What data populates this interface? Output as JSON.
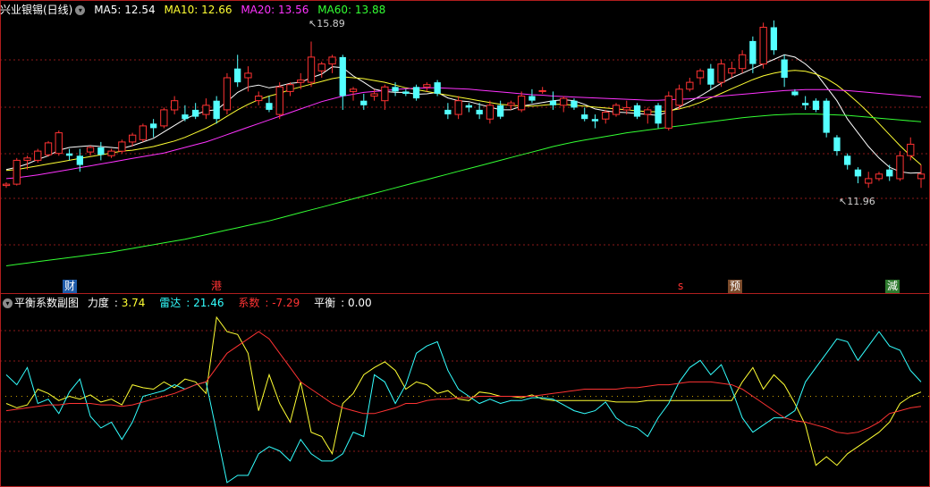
{
  "main_header": {
    "symbol": "兴业银锡(日线)",
    "ma": [
      {
        "label": "MA5: 12.54",
        "color": "#ffffff"
      },
      {
        "label": "MA10: 12.66",
        "color": "#ffff33"
      },
      {
        "label": "MA20: 13.56",
        "color": "#ff33ff"
      },
      {
        "label": "MA60: 13.88",
        "color": "#33ff33"
      }
    ]
  },
  "sub_header": {
    "name": "平衡系数副图",
    "items": [
      {
        "name": "力度",
        "value": "3.74",
        "color": "#ffff33"
      },
      {
        "name": "雷达",
        "value": "21.46",
        "color": "#33ffff"
      },
      {
        "name": "系数",
        "value": "-7.29",
        "color": "#ff3333"
      },
      {
        "name": "平衡",
        "value": "0.00",
        "color": "#ffffff"
      }
    ]
  },
  "annotations": {
    "high": "15.89",
    "low": "11.96"
  },
  "events": [
    {
      "label": "财",
      "bg": "#1e5aa8",
      "color": "#ffffff"
    },
    {
      "label": "港",
      "bg": "#000000",
      "color": "#ff3333"
    },
    {
      "label": "s",
      "bg": "#000000",
      "color": "#ff3333"
    },
    {
      "label": "预",
      "bg": "#7a4a2a",
      "color": "#ffffff"
    },
    {
      "label": "減",
      "bg": "#2e7a2e",
      "color": "#ffffff"
    }
  ],
  "colors": {
    "up": "#ff3232",
    "down": "#54ffff",
    "grid": "#8b1a1a"
  },
  "chart_data": {
    "type": "candlestick",
    "price_range": [
      10.6,
      16.6
    ],
    "candles": [
      [
        12.75,
        12.82,
        12.7,
        12.78
      ],
      [
        12.78,
        13.35,
        12.75,
        13.3
      ],
      [
        13.3,
        13.4,
        13.1,
        13.35
      ],
      [
        13.3,
        13.55,
        13.25,
        13.5
      ],
      [
        13.42,
        13.72,
        13.38,
        13.68
      ],
      [
        13.45,
        13.95,
        13.4,
        13.9
      ],
      [
        13.45,
        13.55,
        13.3,
        13.4
      ],
      [
        13.4,
        13.55,
        13.05,
        13.2
      ],
      [
        13.48,
        13.62,
        13.4,
        13.58
      ],
      [
        13.58,
        13.7,
        13.3,
        13.42
      ],
      [
        13.4,
        13.55,
        13.35,
        13.5
      ],
      [
        13.5,
        13.75,
        13.45,
        13.7
      ],
      [
        13.7,
        13.9,
        13.6,
        13.85
      ],
      [
        13.75,
        14.1,
        13.7,
        14.05
      ],
      [
        14.1,
        14.2,
        13.8,
        14.0
      ],
      [
        14.05,
        14.45,
        14.0,
        14.4
      ],
      [
        14.4,
        14.7,
        14.3,
        14.6
      ],
      [
        14.3,
        14.5,
        14.15,
        14.2
      ],
      [
        14.4,
        14.55,
        14.2,
        14.25
      ],
      [
        14.3,
        14.65,
        14.2,
        14.5
      ],
      [
        14.6,
        14.7,
        14.1,
        14.2
      ],
      [
        14.4,
        15.2,
        14.3,
        15.1
      ],
      [
        15.3,
        15.6,
        14.9,
        15.0
      ],
      [
        15.1,
        15.35,
        14.8,
        15.2
      ],
      [
        14.6,
        14.8,
        14.5,
        14.7
      ],
      [
        14.55,
        14.7,
        14.35,
        14.4
      ],
      [
        14.3,
        15.0,
        14.2,
        14.9
      ],
      [
        14.8,
        15.0,
        14.7,
        14.95
      ],
      [
        15.0,
        15.2,
        14.85,
        15.05
      ],
      [
        15.0,
        15.89,
        14.9,
        15.55
      ],
      [
        15.25,
        15.45,
        15.1,
        15.4
      ],
      [
        15.4,
        15.6,
        15.2,
        15.55
      ],
      [
        15.55,
        15.6,
        14.4,
        14.7
      ],
      [
        14.8,
        14.9,
        14.6,
        14.85
      ],
      [
        14.6,
        14.75,
        14.4,
        14.5
      ],
      [
        14.7,
        14.85,
        14.6,
        14.75
      ],
      [
        14.6,
        14.95,
        14.4,
        14.9
      ],
      [
        14.9,
        15.0,
        14.7,
        14.8
      ],
      [
        14.8,
        14.85,
        14.7,
        14.75
      ],
      [
        14.9,
        14.95,
        14.6,
        14.65
      ],
      [
        14.9,
        15.0,
        14.8,
        14.95
      ],
      [
        15.0,
        15.05,
        14.7,
        14.75
      ],
      [
        14.4,
        14.55,
        14.2,
        14.3
      ],
      [
        14.3,
        14.7,
        14.2,
        14.6
      ],
      [
        14.5,
        14.55,
        14.35,
        14.45
      ],
      [
        14.4,
        14.55,
        14.2,
        14.3
      ],
      [
        14.2,
        14.6,
        14.1,
        14.5
      ],
      [
        14.5,
        14.6,
        14.2,
        14.25
      ],
      [
        14.5,
        14.6,
        14.4,
        14.55
      ],
      [
        14.4,
        14.8,
        14.35,
        14.7
      ],
      [
        14.7,
        14.85,
        14.55,
        14.6
      ],
      [
        14.8,
        14.9,
        14.75,
        14.82
      ],
      [
        14.6,
        14.8,
        14.4,
        14.5
      ],
      [
        14.5,
        14.7,
        14.35,
        14.65
      ],
      [
        14.6,
        14.65,
        14.4,
        14.45
      ],
      [
        14.3,
        14.45,
        14.15,
        14.2
      ],
      [
        14.2,
        14.3,
        14.0,
        14.15
      ],
      [
        14.2,
        14.4,
        14.1,
        14.35
      ],
      [
        14.3,
        14.55,
        14.25,
        14.5
      ],
      [
        14.4,
        14.6,
        14.3,
        14.45
      ],
      [
        14.5,
        14.55,
        14.2,
        14.25
      ],
      [
        14.3,
        14.45,
        14.1,
        14.4
      ],
      [
        14.5,
        14.55,
        14.0,
        14.1
      ],
      [
        14.0,
        14.8,
        13.95,
        14.7
      ],
      [
        14.5,
        14.95,
        14.4,
        14.85
      ],
      [
        14.85,
        15.1,
        14.8,
        15.0
      ],
      [
        15.1,
        15.3,
        14.95,
        15.25
      ],
      [
        15.3,
        15.4,
        14.85,
        14.95
      ],
      [
        15.0,
        15.5,
        14.9,
        15.4
      ],
      [
        15.2,
        15.45,
        15.1,
        15.3
      ],
      [
        15.3,
        15.7,
        15.2,
        15.6
      ],
      [
        15.9,
        16.0,
        15.2,
        15.4
      ],
      [
        15.4,
        16.3,
        15.3,
        16.2
      ],
      [
        16.2,
        16.35,
        15.6,
        15.7
      ],
      [
        15.5,
        15.6,
        14.9,
        15.1
      ],
      [
        14.8,
        14.85,
        14.7,
        14.72
      ],
      [
        14.55,
        14.7,
        14.4,
        14.5
      ],
      [
        14.6,
        14.65,
        14.35,
        14.4
      ],
      [
        14.6,
        14.65,
        13.8,
        13.9
      ],
      [
        13.8,
        13.85,
        13.4,
        13.5
      ],
      [
        13.4,
        13.45,
        13.1,
        13.2
      ],
      [
        13.1,
        13.15,
        12.8,
        12.95
      ],
      [
        12.8,
        13.05,
        12.7,
        12.9
      ],
      [
        12.9,
        13.05,
        12.85,
        13.0
      ],
      [
        13.1,
        13.2,
        12.85,
        12.95
      ],
      [
        12.9,
        13.5,
        12.85,
        13.4
      ],
      [
        13.4,
        13.8,
        13.3,
        13.65
      ],
      [
        12.9,
        13.2,
        12.7,
        13.0
      ]
    ],
    "ma_series": [
      {
        "name": "MA5",
        "values": [
          13.1,
          13.15,
          13.22,
          13.32,
          13.4,
          13.52,
          13.58,
          13.6,
          13.62,
          13.6,
          13.58,
          13.56,
          13.62,
          13.7,
          13.78,
          13.92,
          14.06,
          14.2,
          14.3,
          14.38,
          14.4,
          14.58,
          14.78,
          14.9,
          14.94,
          14.88,
          14.92,
          14.98,
          15.0,
          15.1,
          15.18,
          15.34,
          15.32,
          15.14,
          15.0,
          14.85,
          14.8,
          14.78,
          14.78,
          14.74,
          14.75,
          14.78,
          14.66,
          14.6,
          14.58,
          14.52,
          14.46,
          14.4,
          14.4,
          14.48,
          14.52,
          14.56,
          14.6,
          14.62,
          14.6,
          14.52,
          14.42,
          14.38,
          14.35,
          14.34,
          14.32,
          14.3,
          14.28,
          14.36,
          14.46,
          14.58,
          14.7,
          14.84,
          14.98,
          15.1,
          15.2,
          15.3,
          15.4,
          15.5,
          15.6,
          15.55,
          15.4,
          15.2,
          14.9,
          14.6,
          14.2,
          13.9,
          13.6,
          13.35,
          13.15,
          13.05,
          13.02,
          13.03
        ]
      },
      {
        "name": "MA10",
        "values": [
          13.08,
          13.1,
          13.14,
          13.18,
          13.22,
          13.26,
          13.3,
          13.34,
          13.38,
          13.42,
          13.46,
          13.5,
          13.52,
          13.56,
          13.6,
          13.66,
          13.72,
          13.8,
          13.9,
          14.0,
          14.12,
          14.26,
          14.4,
          14.52,
          14.62,
          14.7,
          14.76,
          14.84,
          14.9,
          14.96,
          15.02,
          15.08,
          15.12,
          15.1,
          15.08,
          15.04,
          15.0,
          14.94,
          14.88,
          14.84,
          14.8,
          14.76,
          14.72,
          14.68,
          14.64,
          14.6,
          14.56,
          14.52,
          14.5,
          14.48,
          14.48,
          14.5,
          14.52,
          14.52,
          14.5,
          14.48,
          14.46,
          14.44,
          14.42,
          14.4,
          14.38,
          14.36,
          14.36,
          14.38,
          14.42,
          14.48,
          14.56,
          14.66,
          14.76,
          14.86,
          14.96,
          15.06,
          15.14,
          15.2,
          15.24,
          15.26,
          15.24,
          15.18,
          15.08,
          14.94,
          14.76,
          14.56,
          14.34,
          14.1,
          13.86,
          13.62,
          13.4,
          13.2
        ]
      },
      {
        "name": "MA20",
        "values": [
          12.9,
          12.92,
          12.95,
          12.98,
          13.02,
          13.06,
          13.1,
          13.14,
          13.18,
          13.22,
          13.26,
          13.3,
          13.34,
          13.38,
          13.42,
          13.46,
          13.52,
          13.58,
          13.64,
          13.7,
          13.78,
          13.86,
          13.94,
          14.02,
          14.1,
          14.18,
          14.26,
          14.34,
          14.42,
          14.5,
          14.58,
          14.64,
          14.7,
          14.74,
          14.78,
          14.8,
          14.82,
          14.84,
          14.86,
          14.87,
          14.88,
          14.88,
          14.87,
          14.86,
          14.85,
          14.83,
          14.81,
          14.79,
          14.77,
          14.75,
          14.73,
          14.72,
          14.7,
          14.69,
          14.68,
          14.67,
          14.66,
          14.65,
          14.64,
          14.63,
          14.62,
          14.61,
          14.61,
          14.62,
          14.63,
          14.64,
          14.66,
          14.68,
          14.7,
          14.72,
          14.74,
          14.76,
          14.78,
          14.8,
          14.82,
          14.83,
          14.84,
          14.84,
          14.84,
          14.83,
          14.82,
          14.8,
          14.78,
          14.76,
          14.74,
          14.72,
          14.7,
          14.68
        ]
      },
      {
        "name": "MA60",
        "values": [
          11.0,
          11.03,
          11.06,
          11.09,
          11.12,
          11.15,
          11.18,
          11.21,
          11.24,
          11.27,
          11.3,
          11.34,
          11.38,
          11.42,
          11.46,
          11.5,
          11.54,
          11.58,
          11.63,
          11.68,
          11.73,
          11.78,
          11.83,
          11.88,
          11.93,
          11.98,
          12.04,
          12.1,
          12.16,
          12.22,
          12.28,
          12.34,
          12.4,
          12.46,
          12.52,
          12.58,
          12.64,
          12.7,
          12.76,
          12.82,
          12.88,
          12.94,
          13.0,
          13.06,
          13.12,
          13.18,
          13.24,
          13.3,
          13.36,
          13.42,
          13.48,
          13.54,
          13.6,
          13.65,
          13.7,
          13.74,
          13.78,
          13.82,
          13.86,
          13.9,
          13.93,
          13.96,
          13.99,
          14.02,
          14.05,
          14.08,
          14.11,
          14.14,
          14.17,
          14.2,
          14.23,
          14.25,
          14.27,
          14.29,
          14.3,
          14.31,
          14.31,
          14.31,
          14.3,
          14.29,
          14.28,
          14.26,
          14.24,
          14.22,
          14.2,
          14.18,
          14.16,
          14.14
        ]
      }
    ],
    "ma_colors": [
      "#ffffff",
      "#ffff33",
      "#ff33ff",
      "#33ff33"
    ],
    "sub_range": [
      -60,
      60
    ],
    "sub_series": [
      {
        "name": "力度",
        "color": "#ffff33",
        "values": [
          -5,
          -8,
          -6,
          5,
          2,
          -3,
          0,
          -2,
          1,
          -4,
          -2,
          -6,
          8,
          6,
          5,
          10,
          6,
          12,
          10,
          2,
          55,
          45,
          43,
          30,
          -10,
          15,
          -5,
          -18,
          10,
          -25,
          -28,
          -40,
          -5,
          2,
          15,
          20,
          24,
          18,
          5,
          10,
          8,
          2,
          4,
          -2,
          -3,
          3,
          2,
          0,
          0,
          -1,
          1,
          -2,
          -3,
          -3,
          -3,
          -3,
          -3,
          -3,
          -4,
          -4,
          -4,
          -3,
          -3,
          -3,
          -3,
          -3,
          -3,
          -3,
          -3,
          -3,
          10,
          20,
          5,
          15,
          8,
          -5,
          -20,
          -48,
          -42,
          -48,
          -40,
          -35,
          -30,
          -25,
          -18,
          -5,
          0,
          3
        ]
      },
      {
        "name": "雷达",
        "color": "#33ffff",
        "values": [
          15,
          8,
          20,
          -5,
          -2,
          -12,
          3,
          12,
          -14,
          -22,
          -18,
          -30,
          -18,
          0,
          2,
          4,
          8,
          5,
          8,
          10,
          -25,
          -60,
          -55,
          -55,
          -40,
          -35,
          -38,
          -45,
          -30,
          -40,
          -45,
          -45,
          -40,
          -25,
          -28,
          15,
          10,
          -5,
          8,
          30,
          35,
          38,
          18,
          5,
          0,
          -5,
          -2,
          -5,
          -3,
          -3,
          -1,
          -1,
          -2,
          -6,
          -10,
          -12,
          -10,
          -4,
          -15,
          -20,
          -22,
          -28,
          -15,
          -5,
          10,
          20,
          25,
          15,
          22,
          5,
          -15,
          -25,
          -20,
          -15,
          -15,
          -10,
          10,
          20,
          30,
          40,
          38,
          25,
          35,
          45,
          35,
          32,
          18,
          10
        ]
      },
      {
        "name": "系数",
        "color": "#ff3333",
        "values": [
          -10,
          -9,
          -8,
          -7,
          -6,
          -6,
          -5,
          -5,
          -5,
          -6,
          -6,
          -7,
          -6,
          -4,
          -2,
          0,
          2,
          5,
          8,
          10,
          20,
          30,
          35,
          40,
          45,
          40,
          30,
          20,
          10,
          5,
          0,
          -5,
          -8,
          -10,
          -12,
          -12,
          -10,
          -8,
          -5,
          -5,
          -3,
          -2,
          -2,
          -1,
          -1,
          0,
          0,
          0,
          0,
          0,
          0,
          1,
          2,
          3,
          4,
          5,
          5,
          5,
          5,
          6,
          6,
          7,
          8,
          8,
          9,
          10,
          10,
          10,
          9,
          8,
          5,
          0,
          -5,
          -10,
          -15,
          -17,
          -18,
          -20,
          -22,
          -25,
          -26,
          -25,
          -22,
          -18,
          -12,
          -10,
          -8,
          -7
        ]
      }
    ]
  }
}
